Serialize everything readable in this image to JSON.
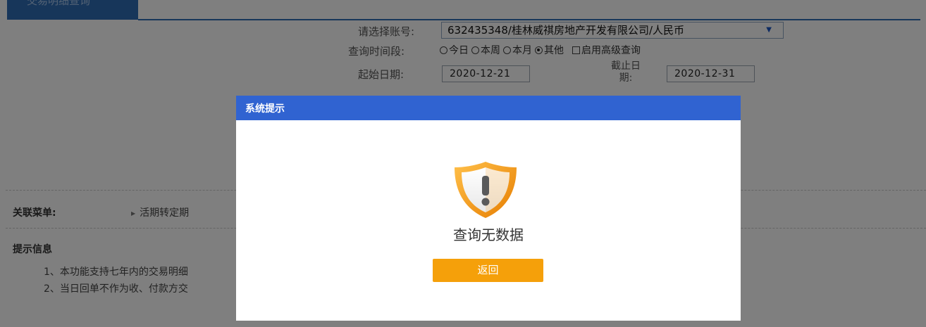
{
  "top_tab": {
    "label": "交易明细查询"
  },
  "form": {
    "account_label": "请选择账号:",
    "account_value": "632435348/桂林威祺房地产开发有限公司/人民币",
    "period_label": "查询时间段:",
    "period_options": [
      {
        "label": "今日",
        "selected": false
      },
      {
        "label": "本周",
        "selected": false
      },
      {
        "label": "本月",
        "selected": false
      },
      {
        "label": "其他",
        "selected": true
      }
    ],
    "advanced_label": "启用高级查询",
    "advanced_checked": false,
    "start_label": "起始日期:",
    "start_value": "2020-12-21",
    "end_label_line1": "截止日",
    "end_label_line2": "期:",
    "end_value": "2020-12-31"
  },
  "related": {
    "label": "关联菜单:",
    "items": [
      "活期转定期"
    ]
  },
  "tips": {
    "title": "提示信息",
    "lines": [
      "1、本功能支持七年内的交易明细",
      "2、当日回单不作为收、付款方交"
    ]
  },
  "modal": {
    "title": "系统提示",
    "icon": "warning-shield-icon",
    "message": "查询无数据",
    "button_label": "返回"
  },
  "colors": {
    "header_blue": "#3063d1",
    "button_orange": "#f5a00a",
    "shield_orange": "#f29400"
  }
}
